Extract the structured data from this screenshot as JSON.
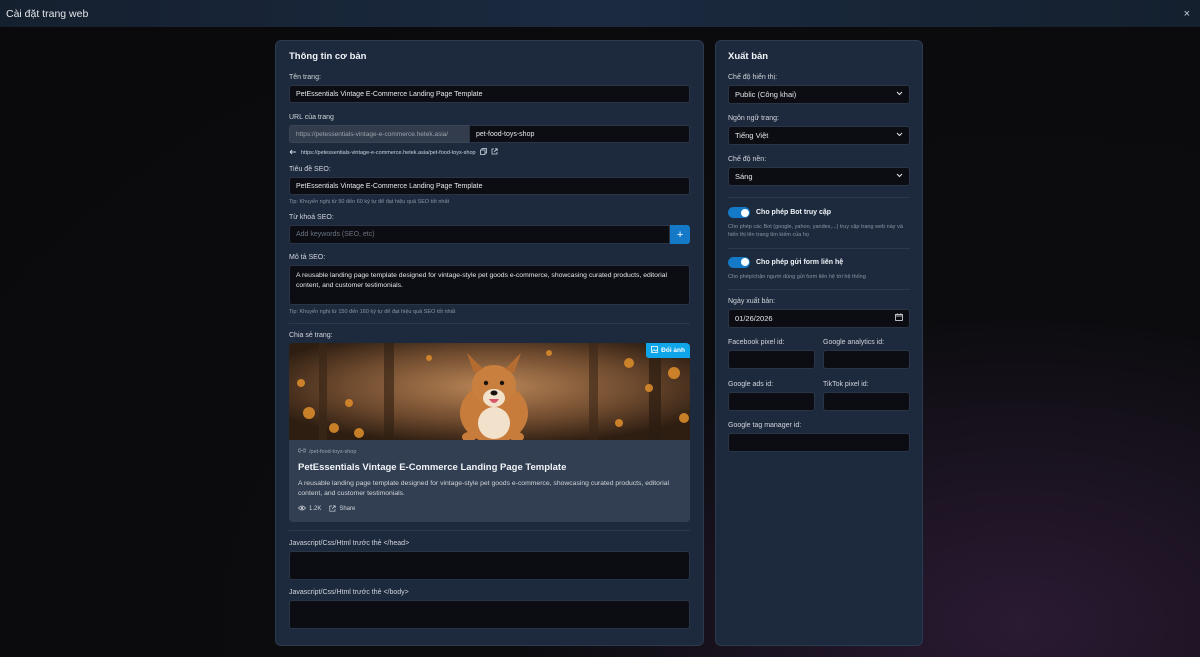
{
  "window": {
    "title": "Cài đặt trang web",
    "close_glyph": "×"
  },
  "basic": {
    "heading": "Thông tin cơ bản",
    "page_name_label": "Tên trang:",
    "page_name_value": "PetEssentials Vintage E-Commerce Landing Page Template",
    "url_label": "URL của trang",
    "url_prefix": "https://petessentials-vintage-e-commerce.hetek.asia/",
    "url_slug": "pet-food-toys-shop",
    "url_full": "https://petessentials-vintage-e-commerce.hetek.asia/pet-food-toys-shop",
    "seo_title_label": "Tiêu đề SEO:",
    "seo_title_value": "PetEssentials Vintage E-Commerce Landing Page Template",
    "seo_title_tip": "Tip: Khuyến nghị từ 50 đến 60 ký tự để đạt hiệu quả SEO tốt nhất",
    "seo_keywords_label": "Từ khoá SEO:",
    "seo_keywords_placeholder": "Add keywords (SEO, etc)",
    "add_glyph": "+",
    "seo_desc_label": "Mô tả SEO:",
    "seo_desc_value": "A reusable landing page template designed for vintage-style pet goods e-commerce, showcasing curated products, editorial content, and customer testimonials.",
    "seo_desc_tip": "Tip: Khuyến nghị từ 150 đến 160 ký tự để đạt hiệu quả SEO tốt nhất",
    "share_label": "Chia sẻ trang:",
    "share": {
      "change_image": "Đổi ảnh",
      "path": "/pet-food-toys-shop",
      "title": "PetEssentials Vintage E-Commerce Landing Page Template",
      "description": "A reusable landing page template designed for vintage-style pet goods e-commerce, showcasing curated products, editorial content, and customer testimonials.",
      "views": "1.2K",
      "share_text": "Share"
    },
    "head_code_label": "Javascript/Css/Html trước thẻ </head>",
    "body_code_label": "Javascript/Css/Html trước thẻ </body>"
  },
  "publish": {
    "heading": "Xuất bản",
    "visibility_label": "Chế độ hiển thị:",
    "visibility_value": "Public (Công khai)",
    "language_label": "Ngôn ngữ trang:",
    "language_value": "Tiếng Việt",
    "theme_label": "Chế độ nền:",
    "theme_value": "Sáng",
    "bot_toggle_label": "Cho phép Bot truy cập",
    "bot_toggle_desc": "Cho phép các Bot (google, yahoo, yandex,...) truy cập trang web này và hiển thị lên trang tìm kiếm của họ",
    "form_toggle_label": "Cho phép gửi form liên hệ",
    "form_toggle_desc": "Cho phép/chặn người dùng gửi form liên hệ tới hệ thống",
    "publish_date_label": "Ngày xuất bản:",
    "publish_date_value": "01/26/2026",
    "facebook_pixel_label": "Facebook pixel id:",
    "google_analytics_label": "Google analytics id:",
    "google_ads_label": "Google ads id:",
    "tiktok_pixel_label": "TikTok pixel id:",
    "gtm_label": "Google tag manager id:"
  },
  "colors": {
    "accent": "#1479c6",
    "change_image_bg": "#0ea5e9",
    "panel": "#1d2a3d"
  }
}
